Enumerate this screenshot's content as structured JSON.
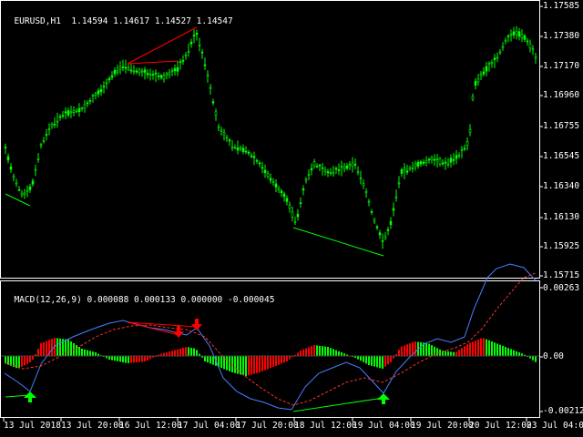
{
  "main_chart": {
    "title": "EURUSD,H1",
    "ohlc": "1.14594 1.14617 1.14527 1.14547",
    "price_ticks": [
      "1.17585",
      "1.17380",
      "1.17170",
      "1.16960",
      "1.16755",
      "1.16545",
      "1.16340",
      "1.16130",
      "1.15925",
      "1.15715"
    ]
  },
  "macd": {
    "title": "MACD(12,26,9)",
    "values": "0.000088 0.000133 0.000000 -0.000045",
    "ticks": [
      "0.00263",
      "0.00",
      "-0.002127"
    ]
  },
  "time_axis": [
    "13 Jul 2018",
    "13 Jul 20:00",
    "16 Jul 12:00",
    "17 Jul 04:00",
    "17 Jul 20:00",
    "18 Jul 12:00",
    "19 Jul 04:00",
    "19 Jul 20:00",
    "20 Jul 12:00",
    "23 Jul 04:00"
  ],
  "colors": {
    "background": "#000000",
    "candle": "#00ff00",
    "frame": "#ffffff",
    "bull_divergence": "#00ff00",
    "bear_divergence": "#ff0000",
    "macd_line": "#4a7fff",
    "signal_line": "#ff3030",
    "hist_positive": "#ff0000",
    "hist_negative": "#00ff00"
  }
}
